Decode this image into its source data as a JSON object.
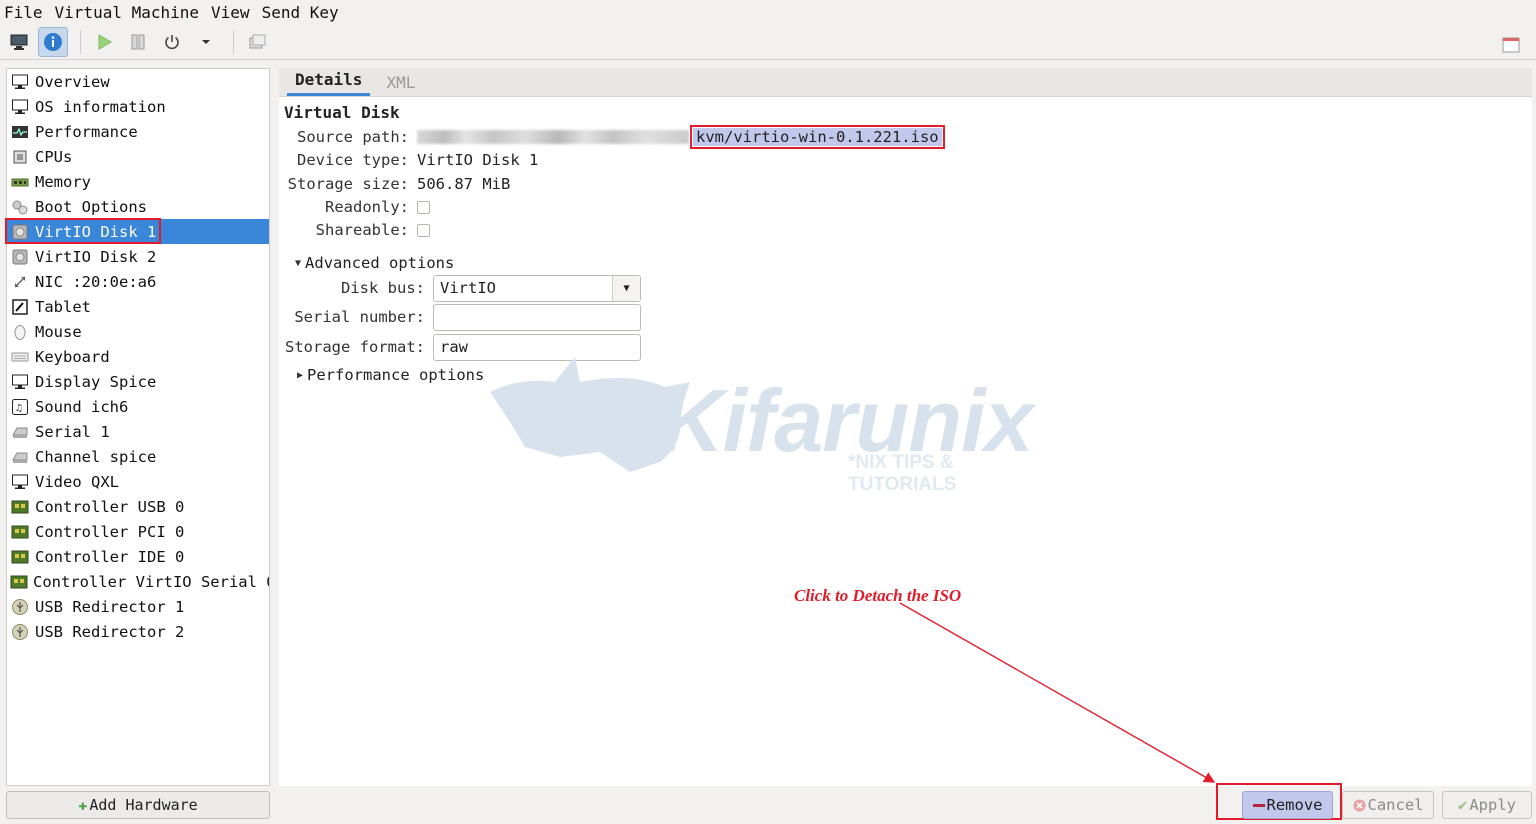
{
  "menu": [
    "File",
    "Virtual Machine",
    "View",
    "Send Key"
  ],
  "toolbar": {
    "buttons": [
      {
        "icon": "monitor-icon",
        "active": false
      },
      {
        "icon": "info-icon",
        "active": true
      },
      {
        "icon": "play-icon",
        "active": false
      },
      {
        "icon": "pause-icon",
        "active": false
      },
      {
        "icon": "power-icon",
        "active": false
      },
      {
        "icon": "dropdown-arrow-icon",
        "active": false
      },
      {
        "icon": "snapshot-icon",
        "active": false
      }
    ],
    "right_icon": "fullscreen-icon"
  },
  "sidebar": {
    "items": [
      {
        "label": "Overview",
        "icon": "monitor-icon"
      },
      {
        "label": "OS information",
        "icon": "monitor-icon"
      },
      {
        "label": "Performance",
        "icon": "performance-icon"
      },
      {
        "label": "CPUs",
        "icon": "cpu-icon"
      },
      {
        "label": "Memory",
        "icon": "memory-icon"
      },
      {
        "label": "Boot Options",
        "icon": "gears-icon"
      },
      {
        "label": "VirtIO Disk 1",
        "icon": "disk-icon",
        "selected": true
      },
      {
        "label": "VirtIO Disk 2",
        "icon": "disk-icon"
      },
      {
        "label": "NIC :20:0e:a6",
        "icon": "network-icon"
      },
      {
        "label": "Tablet",
        "icon": "tablet-icon"
      },
      {
        "label": "Mouse",
        "icon": "mouse-icon"
      },
      {
        "label": "Keyboard",
        "icon": "keyboard-icon"
      },
      {
        "label": "Display Spice",
        "icon": "monitor-icon"
      },
      {
        "label": "Sound ich6",
        "icon": "sound-icon"
      },
      {
        "label": "Serial 1",
        "icon": "serial-icon"
      },
      {
        "label": "Channel spice",
        "icon": "serial-icon"
      },
      {
        "label": "Video QXL",
        "icon": "monitor-icon"
      },
      {
        "label": "Controller USB 0",
        "icon": "controller-icon"
      },
      {
        "label": "Controller PCI 0",
        "icon": "controller-icon"
      },
      {
        "label": "Controller IDE 0",
        "icon": "controller-icon"
      },
      {
        "label": "Controller VirtIO Serial 0",
        "icon": "controller-icon"
      },
      {
        "label": "USB Redirector 1",
        "icon": "usb-icon"
      },
      {
        "label": "USB Redirector 2",
        "icon": "usb-icon"
      }
    ],
    "add_hardware": "Add Hardware"
  },
  "tabs": [
    {
      "label": "Details",
      "active": true
    },
    {
      "label": "XML",
      "active": false
    }
  ],
  "details": {
    "section": "Virtual Disk",
    "source_path_label": "Source path:",
    "source_path_value": "kvm/virtio-win-0.1.221.iso",
    "device_type_label": "Device type:",
    "device_type_value": "VirtIO Disk 1",
    "storage_size_label": "Storage size:",
    "storage_size_value": "506.87 MiB",
    "readonly_label": "Readonly:",
    "readonly_checked": false,
    "shareable_label": "Shareable:",
    "shareable_checked": false,
    "advanced_label": "Advanced options",
    "disk_bus_label": "Disk bus:",
    "disk_bus_value": "VirtIO",
    "serial_label": "Serial number:",
    "serial_value": "",
    "storage_format_label": "Storage format:",
    "storage_format_value": "raw",
    "performance_label": "Performance options"
  },
  "watermark": {
    "word": "Kifarunix",
    "tagline": "*NIX TIPS & TUTORIALS"
  },
  "annotation": "Click to Detach the ISO",
  "buttons": {
    "remove": "Remove",
    "cancel": "Cancel",
    "apply": "Apply"
  },
  "colors": {
    "selection": "#3a86d9",
    "highlight_box": "#e21b2b",
    "remove_bg": "#c2c7ec"
  }
}
